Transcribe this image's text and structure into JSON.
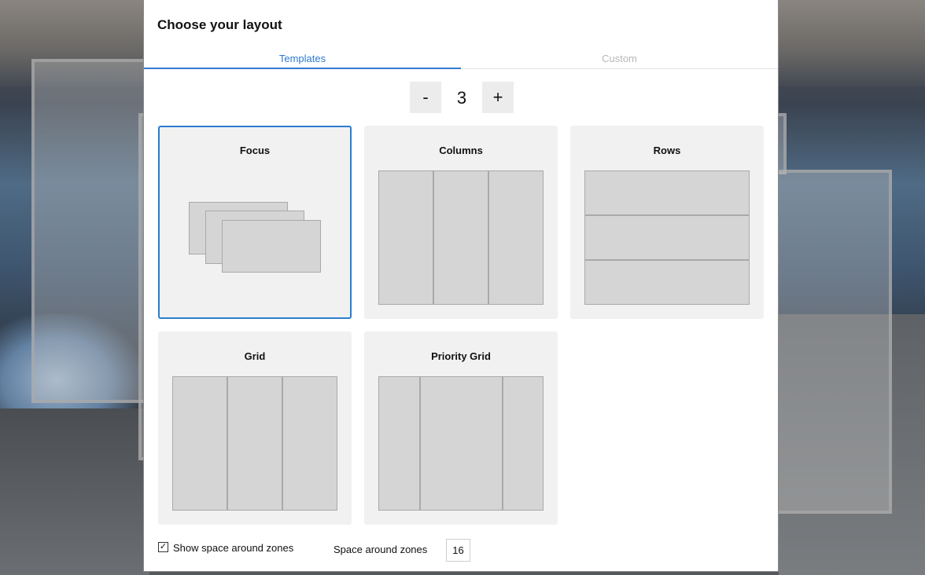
{
  "dialog": {
    "title": "Choose your layout"
  },
  "tabs": [
    {
      "label": "Templates",
      "active": true
    },
    {
      "label": "Custom",
      "active": false
    }
  ],
  "zone_count": {
    "minus_label": "-",
    "value": "3",
    "plus_label": "+"
  },
  "templates": [
    {
      "label": "Focus",
      "selected": true
    },
    {
      "label": "Columns",
      "selected": false
    },
    {
      "label": "Rows",
      "selected": false
    },
    {
      "label": "Grid",
      "selected": false
    },
    {
      "label": "Priority Grid",
      "selected": false
    }
  ],
  "footer": {
    "show_space_label": "Show space around zones",
    "show_space_checked": true,
    "check_mark": "✓",
    "space_label": "Space around zones",
    "space_value": "16"
  },
  "colors": {
    "accent": "#2f7bd1",
    "card_bg": "#f1f1f1",
    "zone_fill": "#d5d5d5"
  }
}
